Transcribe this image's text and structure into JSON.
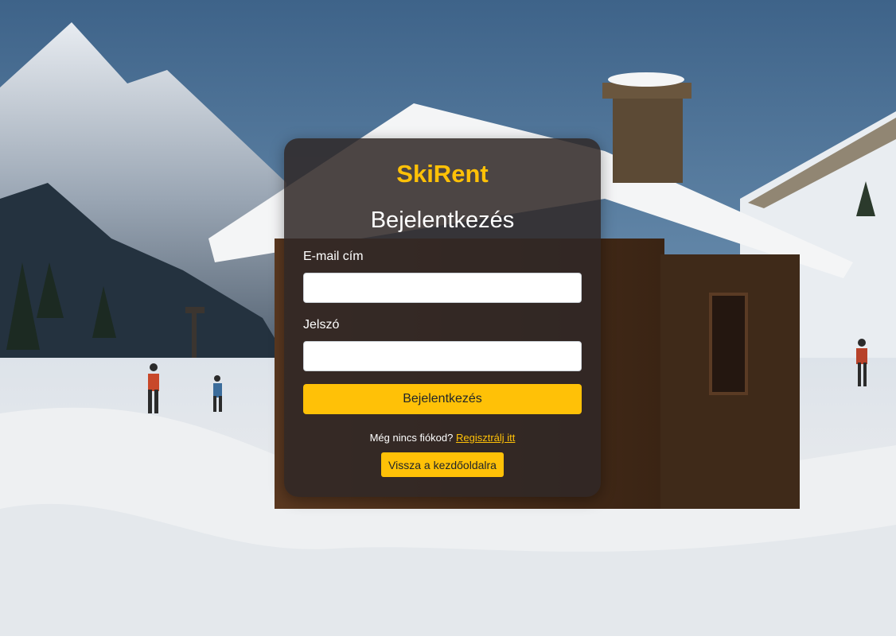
{
  "app": {
    "brand": "SkiRent"
  },
  "login": {
    "title": "Bejelentkezés",
    "email_label": "E-mail cím",
    "email_value": "",
    "password_label": "Jelszó",
    "password_value": "",
    "submit_label": "Bejelentkezés",
    "register_prompt": "Még nincs fiókod?",
    "register_link": "Regisztrálj itt",
    "back_label": "Vissza a kezdőoldalra"
  },
  "colors": {
    "accent": "#ffc107",
    "card_background": "#302826",
    "text": "#ffffff"
  },
  "background": {
    "description_icon": "mountain-cabin-background"
  }
}
